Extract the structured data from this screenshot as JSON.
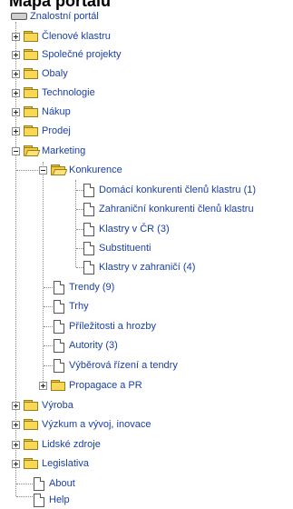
{
  "heading": "Mapa portálu",
  "root_label": "Znalostní portál",
  "top_items": [
    {
      "label": "Členové klastru"
    },
    {
      "label": "Společné projekty"
    },
    {
      "label": "Obaly"
    },
    {
      "label": "Technologie"
    },
    {
      "label": "Nákup"
    },
    {
      "label": "Prodej"
    }
  ],
  "marketing": {
    "label": "Marketing",
    "konkurence": {
      "label": "Konkurence",
      "children": [
        {
          "label": "Domácí konkurenti členů klastru (1)"
        },
        {
          "label": "Zahraniční konkurenti členů klastru"
        },
        {
          "label": "Klastry v ČR (3)"
        },
        {
          "label": "Substituenti"
        },
        {
          "label": "Klastry v zahraničí (4)"
        }
      ]
    },
    "docs": [
      {
        "label": "Trendy (9)"
      },
      {
        "label": "Trhy"
      },
      {
        "label": "Příležitosti a hrozby"
      },
      {
        "label": "Autority (3)"
      },
      {
        "label": "Výběrová řízení a tendry"
      }
    ],
    "propagace": {
      "label": "Propagace a PR"
    }
  },
  "bottom_items": [
    {
      "label": "Výroba"
    },
    {
      "label": "Výzkum a vývoj, inovace"
    },
    {
      "label": "Lidské zdroje"
    },
    {
      "label": "Legislativa"
    }
  ],
  "bottom_docs": [
    {
      "label": "About"
    },
    {
      "label": "Help"
    }
  ]
}
